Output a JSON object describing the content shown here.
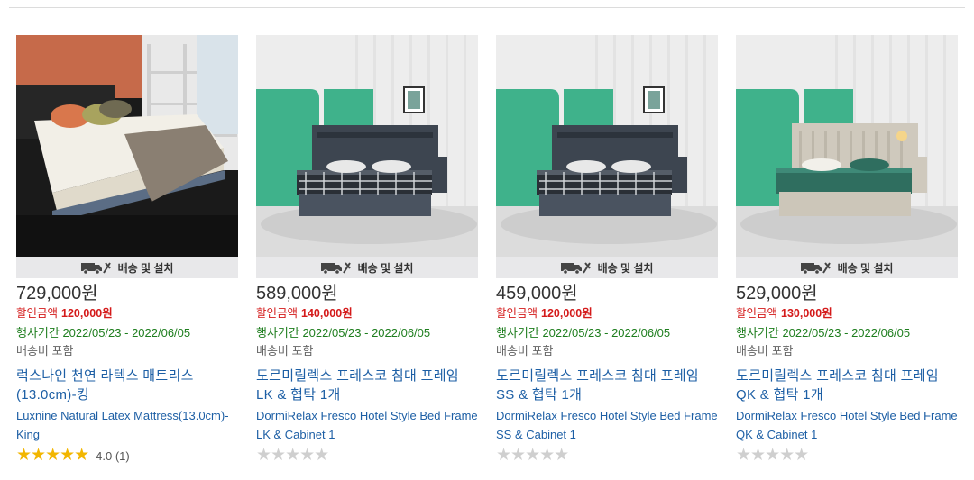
{
  "products": [
    {
      "shipping_label": "배송 및 설치",
      "price": "729,000원",
      "discount_label": "할인금액",
      "discount_amount": "120,000원",
      "period": "행사기간 2022/05/23 - 2022/06/05",
      "shipping_fee": "배송비 포함",
      "name_ko": "럭스나인 천연 라텍스 매트리스 (13.0cm)-킹",
      "name_en": "Luxnine Natural Latex Mattress(13.0cm)-King",
      "stars": "★★★★★",
      "rating_text": "4.0 (1)",
      "rated": true
    },
    {
      "shipping_label": "배송 및 설치",
      "price": "589,000원",
      "discount_label": "할인금액",
      "discount_amount": "140,000원",
      "period": "행사기간 2022/05/23 - 2022/06/05",
      "shipping_fee": "배송비 포함",
      "name_ko": "도르미릴렉스 프레스코 침대 프레임 LK & 협탁 1개",
      "name_en": "DormiRelax Fresco Hotel Style Bed Frame LK & Cabinet 1",
      "stars": "★★★★★",
      "rating_text": "",
      "rated": false
    },
    {
      "shipping_label": "배송 및 설치",
      "price": "459,000원",
      "discount_label": "할인금액",
      "discount_amount": "120,000원",
      "period": "행사기간 2022/05/23 - 2022/06/05",
      "shipping_fee": "배송비 포함",
      "name_ko": "도르미릴렉스 프레스코 침대 프레임 SS & 협탁 1개",
      "name_en": "DormiRelax Fresco Hotel Style Bed Frame SS & Cabinet 1",
      "stars": "★★★★★",
      "rating_text": "",
      "rated": false
    },
    {
      "shipping_label": "배송 및 설치",
      "price": "529,000원",
      "discount_label": "할인금액",
      "discount_amount": "130,000원",
      "period": "행사기간 2022/05/23 - 2022/06/05",
      "shipping_fee": "배송비 포함",
      "name_ko": "도르미릴렉스 프레스코 침대 프레임 QK & 협탁 1개",
      "name_en": "DormiRelax Fresco Hotel Style Bed Frame QK & Cabinet 1",
      "stars": "★★★★★",
      "rating_text": "",
      "rated": false
    }
  ],
  "colors": {
    "price_discount": "#d41a1a",
    "period": "#1e7e1e",
    "link": "#1d5fa5",
    "star_gold": "#f2b600",
    "star_gray": "#cfcfcf"
  },
  "icons": {
    "shipping": "truck-tools-icon",
    "rating": "star-icon"
  }
}
